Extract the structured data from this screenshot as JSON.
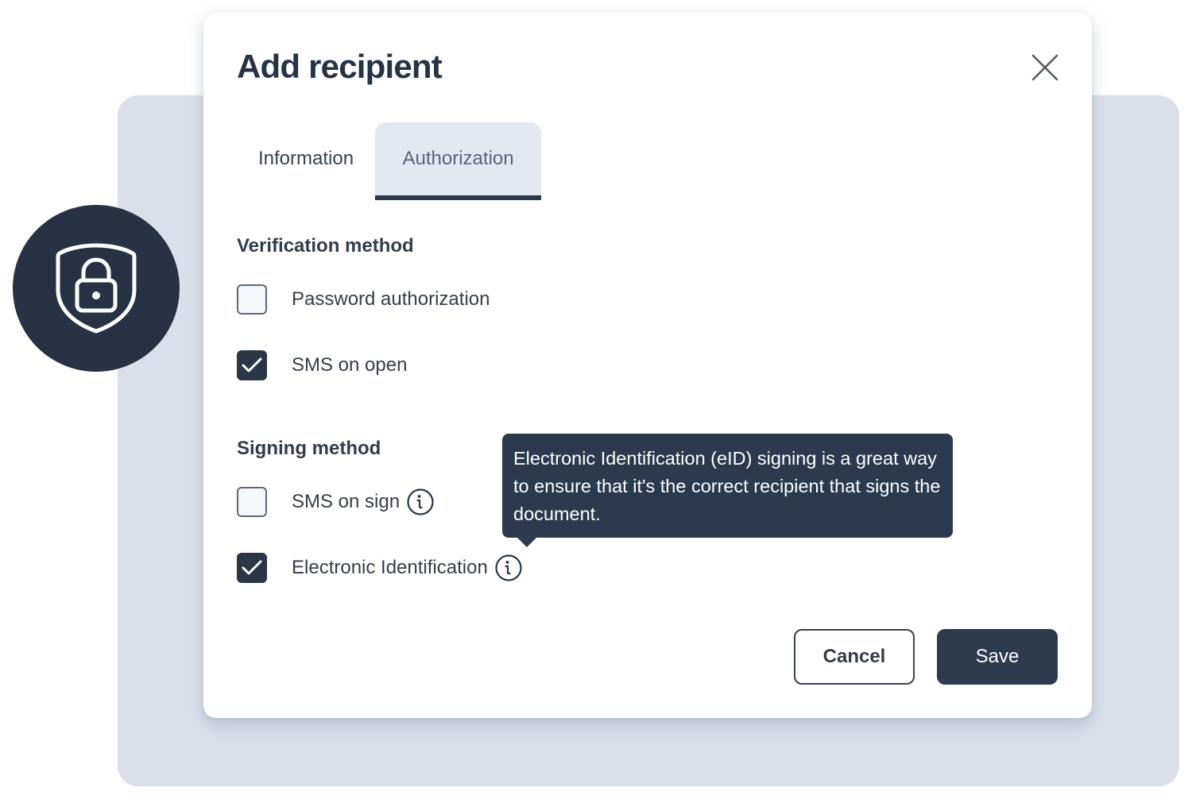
{
  "colors": {
    "primary": "#2b3646",
    "backdrop": "#d9e0e9",
    "active_tab_bg": "#e2e8f0",
    "tooltip_bg": "#2b3a4e"
  },
  "badge": {
    "icon": "shield-lock-icon"
  },
  "dialog": {
    "title": "Add recipient",
    "close_icon": "close-icon",
    "tabs": [
      {
        "label": "Information",
        "active": false
      },
      {
        "label": "Authorization",
        "active": true
      }
    ],
    "verification": {
      "title": "Verification method",
      "options": [
        {
          "label": "Password authorization",
          "checked": false
        },
        {
          "label": "SMS on open",
          "checked": true
        }
      ]
    },
    "signing": {
      "title": "Signing method",
      "options": [
        {
          "label": "SMS on sign",
          "checked": false,
          "info": "info-icon"
        },
        {
          "label": "Electronic Identification",
          "checked": true,
          "info": "info-icon"
        }
      ]
    },
    "tooltip": {
      "text": "Electronic Identification (eID) signing is a great way to ensure that it's the correct recipient that signs the document."
    },
    "buttons": {
      "cancel": "Cancel",
      "save": "Save"
    }
  }
}
